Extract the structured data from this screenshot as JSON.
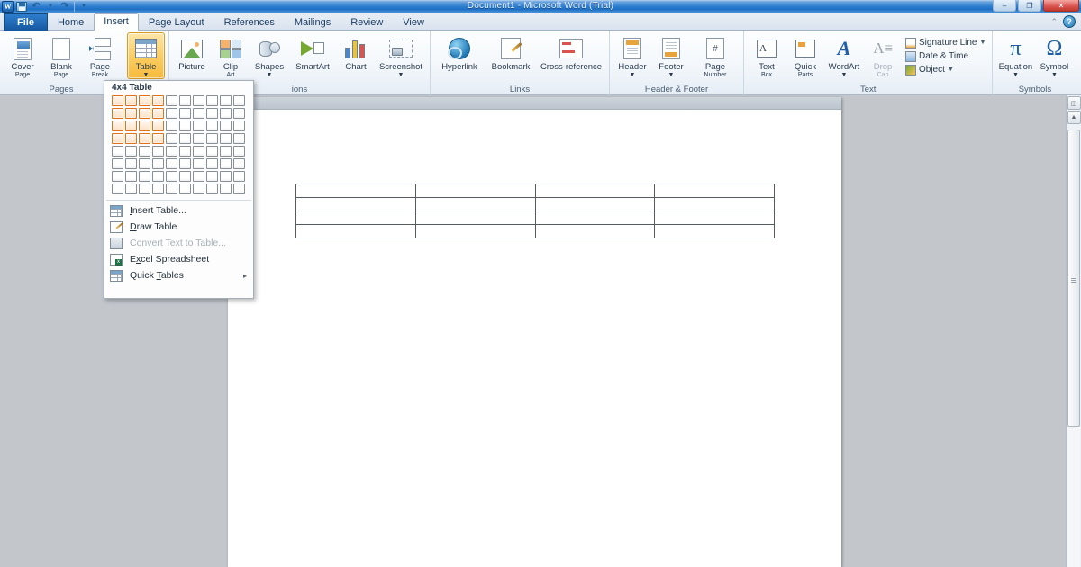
{
  "window": {
    "title": "Document1 - Microsoft Word (Trial)",
    "quick_access": {
      "app_icon": "word-icon",
      "save": "save-icon",
      "undo": "undo-icon",
      "redo": "redo-icon",
      "customize": "customize-qat-icon"
    },
    "controls": {
      "minimize": "–",
      "restore": "❐",
      "close": "✕"
    },
    "ribbon_minimize": "⌃",
    "help": "?"
  },
  "tabs": [
    {
      "label": "File",
      "active": false,
      "kind": "file"
    },
    {
      "label": "Home",
      "active": false,
      "kind": "normal"
    },
    {
      "label": "Insert",
      "active": true,
      "kind": "normal"
    },
    {
      "label": "Page Layout",
      "active": false,
      "kind": "normal"
    },
    {
      "label": "References",
      "active": false,
      "kind": "normal"
    },
    {
      "label": "Mailings",
      "active": false,
      "kind": "normal"
    },
    {
      "label": "Review",
      "active": false,
      "kind": "normal"
    },
    {
      "label": "View",
      "active": false,
      "kind": "normal"
    }
  ],
  "ribbon": {
    "groups": [
      {
        "name": "Pages",
        "label": "Pages",
        "buttons": [
          {
            "label": "Cover",
            "label2": "Page",
            "caret": true,
            "icon": "cover-page-icon"
          },
          {
            "label": "Blank",
            "label2": "Page",
            "caret": false,
            "icon": "blank-page-icon"
          },
          {
            "label": "Page",
            "label2": "Break",
            "caret": false,
            "icon": "page-break-icon"
          }
        ]
      },
      {
        "name": "Tables",
        "label": "",
        "buttons": [
          {
            "label": "Table",
            "label2": "",
            "caret": true,
            "icon": "table-icon",
            "active": true
          }
        ]
      },
      {
        "name": "Illustrations",
        "label": "Illustrations",
        "label_visible": "ions",
        "buttons": [
          {
            "label": "Picture",
            "label2": "",
            "caret": false,
            "icon": "picture-icon"
          },
          {
            "label": "Clip",
            "label2": "Art",
            "caret": false,
            "icon": "clip-art-icon"
          },
          {
            "label": "Shapes",
            "label2": "",
            "caret": true,
            "icon": "shapes-icon"
          },
          {
            "label": "SmartArt",
            "label2": "",
            "caret": false,
            "icon": "smartart-icon"
          },
          {
            "label": "Chart",
            "label2": "",
            "caret": false,
            "icon": "chart-icon"
          },
          {
            "label": "Screenshot",
            "label2": "",
            "caret": true,
            "icon": "screenshot-icon"
          }
        ]
      },
      {
        "name": "Links",
        "label": "Links",
        "buttons": [
          {
            "label": "Hyperlink",
            "label2": "",
            "caret": false,
            "icon": "hyperlink-icon"
          },
          {
            "label": "Bookmark",
            "label2": "",
            "caret": false,
            "icon": "bookmark-icon"
          },
          {
            "label": "Cross-reference",
            "label2": "",
            "caret": false,
            "icon": "cross-reference-icon"
          }
        ]
      },
      {
        "name": "Header & Footer",
        "label": "Header & Footer",
        "buttons": [
          {
            "label": "Header",
            "label2": "",
            "caret": true,
            "icon": "header-icon"
          },
          {
            "label": "Footer",
            "label2": "",
            "caret": true,
            "icon": "footer-icon"
          },
          {
            "label": "Page",
            "label2": "Number",
            "caret": true,
            "icon": "page-number-icon"
          }
        ]
      },
      {
        "name": "Text",
        "label": "Text",
        "buttons": [
          {
            "label": "Text",
            "label2": "Box",
            "caret": true,
            "icon": "text-box-icon"
          },
          {
            "label": "Quick",
            "label2": "Parts",
            "caret": true,
            "icon": "quick-parts-icon"
          },
          {
            "label": "WordArt",
            "label2": "",
            "caret": true,
            "icon": "wordart-icon"
          },
          {
            "label": "Drop",
            "label2": "Cap",
            "caret": true,
            "icon": "drop-cap-icon",
            "disabled": true
          }
        ],
        "small_buttons": [
          {
            "label": "Signature Line",
            "caret": true,
            "icon": "signature-line-icon"
          },
          {
            "label": "Date & Time",
            "caret": false,
            "icon": "date-time-icon"
          },
          {
            "label": "Object",
            "caret": true,
            "icon": "object-icon"
          }
        ]
      },
      {
        "name": "Symbols",
        "label": "Symbols",
        "buttons": [
          {
            "label": "Equation",
            "label2": "",
            "caret": true,
            "icon": "equation-icon",
            "glyph": "π"
          },
          {
            "label": "Symbol",
            "label2": "",
            "caret": true,
            "icon": "symbol-icon",
            "glyph": "Ω"
          }
        ]
      }
    ]
  },
  "table_dropdown": {
    "title": "4x4 Table",
    "grid": {
      "columns": 10,
      "rows": 8,
      "selected_columns": 4,
      "selected_rows": 4,
      "selected_color": "#e0711d",
      "cell_color": "#ffffff"
    },
    "menu_items": [
      {
        "label": "Insert Table...",
        "accel": "I",
        "icon": "insert-table-icon",
        "disabled": false,
        "submenu": false
      },
      {
        "label": "Draw Table",
        "accel": "D",
        "icon": "draw-table-icon",
        "disabled": false,
        "submenu": false
      },
      {
        "label": "Convert Text to Table...",
        "accel": "v",
        "icon": "convert-text-icon",
        "disabled": true,
        "submenu": false
      },
      {
        "label": "Excel Spreadsheet",
        "accel": "x",
        "icon": "excel-spreadsheet-icon",
        "disabled": false,
        "submenu": false
      },
      {
        "label": "Quick Tables",
        "accel": "T",
        "icon": "quick-tables-icon",
        "disabled": false,
        "submenu": true,
        "submenu_arrow": "▸"
      }
    ]
  },
  "document": {
    "inserted_table": {
      "rows": 4,
      "columns": 4,
      "cells": [
        [
          "",
          "",
          "",
          ""
        ],
        [
          "",
          "",
          "",
          ""
        ],
        [
          "",
          "",
          "",
          ""
        ],
        [
          "",
          "",
          "",
          ""
        ]
      ]
    }
  },
  "scrollbar": {
    "ruler_toggle": "view-ruler-icon",
    "up_arrow": "▲"
  }
}
